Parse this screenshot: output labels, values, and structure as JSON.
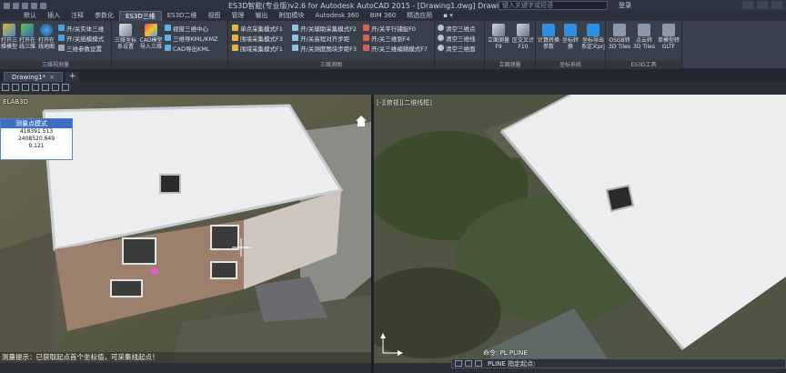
{
  "titlebar": {
    "title": "ES3D智能(专业版)v2.6 for Autodesk AutoCAD 2015 - [Drawing1.dwg]      Drawing1.dwg",
    "search_placeholder": "键入关键字或短语",
    "user": "登录"
  },
  "menu_tabs": [
    {
      "label": "默认",
      "active": false
    },
    {
      "label": "插入",
      "active": false
    },
    {
      "label": "注释",
      "active": false
    },
    {
      "label": "参数化",
      "active": false
    },
    {
      "label": "ES3D三维",
      "active": true
    },
    {
      "label": "ES3D二维",
      "active": false
    },
    {
      "label": "视图",
      "active": false
    },
    {
      "label": "管理",
      "active": false
    },
    {
      "label": "输出",
      "active": false
    },
    {
      "label": "附加模块",
      "active": false
    },
    {
      "label": "Autodesk 360",
      "active": false
    },
    {
      "label": "BIM 360",
      "active": false
    },
    {
      "label": "精选应用",
      "active": false
    },
    {
      "label": "▪ ▾",
      "active": false
    }
  ],
  "ribbon": {
    "group1": {
      "label": "三维视测量",
      "buttons": [
        "打开三维模型",
        "打开在线三维",
        "打开在线地图"
      ],
      "small": [
        "开/关实体三维",
        "开/关纸模模式",
        "三维参数设置"
      ]
    },
    "group2": {
      "label": "",
      "buttons": [
        "三维坐标系设置",
        "CAD模型导入三维"
      ],
      "small": [
        "视窗三维中心",
        "三维导KML/KMZ",
        "CAD导出KML"
      ]
    },
    "group3": {
      "label": "三维测图",
      "small_a": [
        "单点采集模式F1",
        "围墙采集模式F3",
        "围域采集模式F1"
      ],
      "small_b": [
        "开/关辅助采集模式F2",
        "开/关高程对齐步距",
        "开/关测度图块步距F3"
      ],
      "small_c": [
        "开/关平行捕捉F0",
        "开/关三维到F4",
        "开/关三维编辑模式F7"
      ]
    },
    "group4": {
      "label": "",
      "small": [
        "清空三维点",
        "清空三维线",
        "清空三维面"
      ]
    },
    "group5": {
      "label": "立面测量",
      "buttons": [
        "立面测量F9",
        "区交叉计F10"
      ]
    },
    "group6": {
      "label": "坐标系统",
      "buttons": [
        "计算转换参数",
        "坐标转换",
        "坐标导出系定义prj"
      ]
    },
    "group7": {
      "label": "ES3D工具",
      "buttons": [
        "OSGB转3D Tiles",
        "点云转3D Tiles",
        "单模型转GLTF"
      ]
    }
  },
  "file_tab": {
    "label": "Drawing1*",
    "close": "×",
    "add": "+"
  },
  "left_viewport": {
    "label": "ELAB3D",
    "popup": {
      "title": "测量点模式",
      "values": [
        "418391.513",
        "2408520.649",
        "9.121"
      ]
    },
    "prompt": "测量提示：已获取起点首个坐标值，可采集线起点！"
  },
  "right_viewport": {
    "label": "[-][俯视][二维线框]"
  },
  "command": {
    "history": "命令: PL PLINE",
    "current": "PLINE 指定起点:"
  },
  "colors": {
    "accent_tab": "#3f4a5c",
    "popup_header": "#3a6fc4",
    "ribbon_bg": "#3a404b"
  }
}
